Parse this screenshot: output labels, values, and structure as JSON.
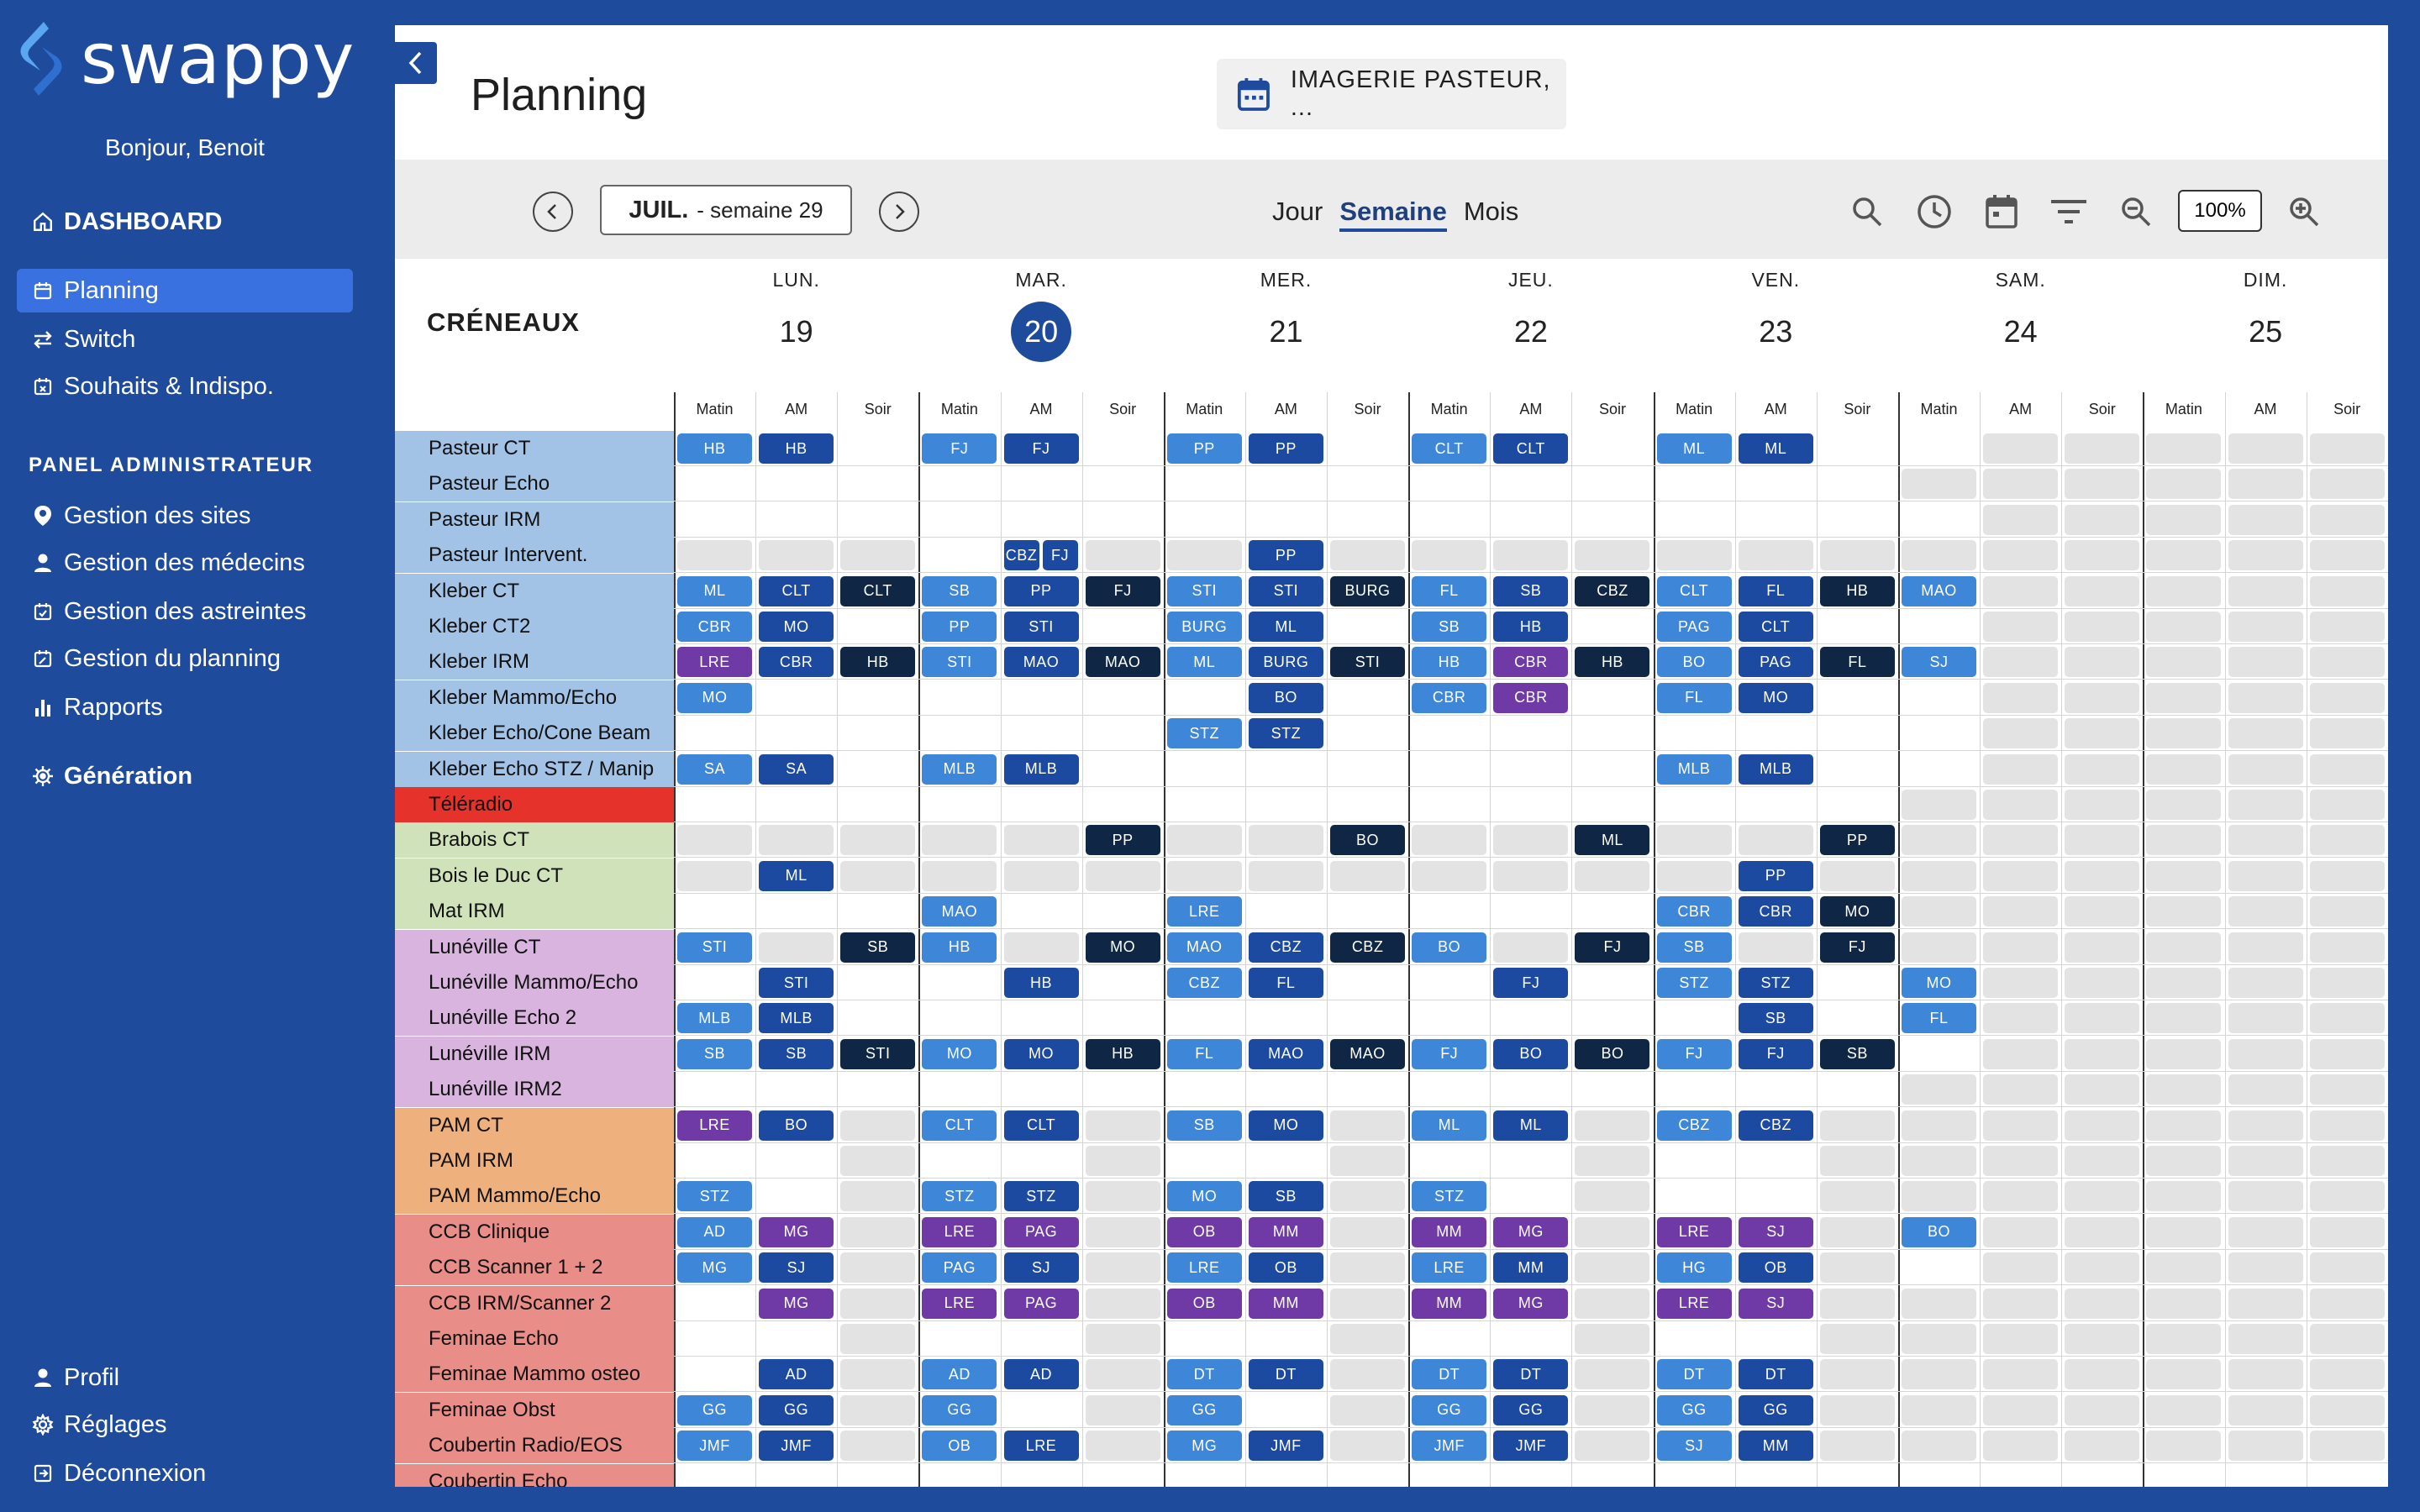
{
  "app": {
    "brand": "swappy",
    "greeting": "Bonjour, Benoit"
  },
  "nav": [
    {
      "label": "DASHBOARD",
      "icon": "home-icon",
      "bold": true
    },
    {
      "label": "Planning",
      "icon": "calendar-icon",
      "selected": true
    },
    {
      "label": "Switch",
      "icon": "swap-icon"
    },
    {
      "label": "Souhaits & Indispo.",
      "icon": "calendar-x-icon"
    }
  ],
  "admin_title": "PANEL ADMINISTRATEUR",
  "admin": [
    {
      "label": "Gestion des sites",
      "icon": "location-icon"
    },
    {
      "label": "Gestion des médecins",
      "icon": "person-icon"
    },
    {
      "label": "Gestion des astreintes",
      "icon": "calendar-check-icon"
    },
    {
      "label": "Gestion du planning",
      "icon": "calendar-edit-icon"
    },
    {
      "label": "Rapports",
      "icon": "bar-chart-icon"
    }
  ],
  "generation": "Génération",
  "bottom": [
    {
      "label": "Profil",
      "icon": "person-icon"
    },
    {
      "label": "Réglages",
      "icon": "gear-icon"
    },
    {
      "label": "Déconnexion",
      "icon": "logout-icon"
    }
  ],
  "header": {
    "title": "Planning",
    "site": "IMAGERIE PASTEUR, ..."
  },
  "toolbar": {
    "month": "JUIL.",
    "week": "- semaine 29",
    "views": [
      "Jour",
      "Semaine",
      "Mois"
    ],
    "active_view": "Semaine",
    "zoom": "100%"
  },
  "creneaux": "CRÉNEAUX",
  "days": [
    {
      "name": "LUN.",
      "num": "19"
    },
    {
      "name": "MAR.",
      "num": "20",
      "today": true
    },
    {
      "name": "MER.",
      "num": "21"
    },
    {
      "name": "JEU.",
      "num": "22"
    },
    {
      "name": "VEN.",
      "num": "23"
    },
    {
      "name": "SAM.",
      "num": "24"
    },
    {
      "name": "DIM.",
      "num": "25"
    }
  ],
  "slots": [
    "Matin",
    "AM",
    "Soir"
  ],
  "colors": {
    "light": "#3d86d8",
    "mid": "#1c4aa0",
    "dark": "#0f2745",
    "purple": "#6f3aa6",
    "blue": "#a2c3e6",
    "red": "#e5322b",
    "green": "#cfe2ba",
    "lilac": "#d8b4df",
    "orange": "#eeb07d",
    "pink": "#e88d87"
  },
  "rows": [
    {
      "label": "Pasteur CT",
      "color": "blue",
      "cells": [
        "L:HB",
        "M:HB",
        "",
        "L:FJ",
        "M:FJ",
        "",
        "L:PP",
        "M:PP",
        "",
        "L:CLT",
        "M:CLT",
        "",
        "L:ML",
        "M:ML",
        "",
        "",
        "g",
        "g",
        "g",
        "g",
        "g"
      ]
    },
    {
      "label": "Pasteur Echo",
      "color": "blue",
      "cells": [
        "",
        "",
        "",
        "",
        "",
        "",
        "",
        "",
        "",
        "",
        "",
        "",
        "",
        "",
        "",
        "g",
        "g",
        "g",
        "g",
        "g",
        "g"
      ]
    },
    {
      "label": "Pasteur IRM",
      "color": "blue",
      "cells": [
        "",
        "",
        "",
        "",
        "",
        "",
        "",
        "",
        "",
        "",
        "",
        "",
        "",
        "",
        "",
        "",
        "g",
        "g",
        "g",
        "g",
        "g"
      ]
    },
    {
      "label": "Pasteur Intervent.",
      "color": "blue",
      "cells": [
        "g",
        "g",
        "g",
        "",
        "M:CBZ|M:FJ",
        "g",
        "g",
        "M:PP",
        "g",
        "g",
        "g",
        "g",
        "g",
        "g",
        "g",
        "g",
        "g",
        "g",
        "g",
        "g",
        "g"
      ]
    },
    {
      "label": "Kleber CT",
      "color": "blue",
      "cells": [
        "L:ML",
        "M:CLT",
        "D:CLT",
        "L:SB",
        "M:PP",
        "D:FJ",
        "L:STI",
        "M:STI",
        "D:BURG",
        "L:FL",
        "M:SB",
        "D:CBZ",
        "L:CLT",
        "M:FL",
        "D:HB",
        "L:MAO",
        "g",
        "g",
        "g",
        "g",
        "g"
      ]
    },
    {
      "label": "Kleber CT2",
      "color": "blue",
      "cells": [
        "L:CBR",
        "M:MO",
        "",
        "L:PP",
        "M:STI",
        "",
        "L:BURG",
        "M:ML",
        "",
        "L:SB",
        "M:HB",
        "",
        "L:PAG",
        "M:CLT",
        "",
        "",
        "g",
        "g",
        "g",
        "g",
        "g"
      ]
    },
    {
      "label": "Kleber IRM",
      "color": "blue",
      "cells": [
        "P:LRE",
        "M:CBR",
        "D:HB",
        "L:STI",
        "M:MAO",
        "D:MAO",
        "L:ML",
        "M:BURG",
        "D:STI",
        "L:HB",
        "P:CBR",
        "D:HB",
        "L:BO",
        "M:PAG",
        "D:FL",
        "L:SJ",
        "g",
        "g",
        "g",
        "g",
        "g"
      ]
    },
    {
      "label": "Kleber Mammo/Echo",
      "color": "blue",
      "cells": [
        "L:MO",
        "",
        "",
        "",
        "",
        "",
        "",
        "M:BO",
        "",
        "L:CBR",
        "P:CBR",
        "",
        "L:FL",
        "M:MO",
        "",
        "",
        "g",
        "g",
        "g",
        "g",
        "g"
      ]
    },
    {
      "label": "Kleber Echo/Cone Beam",
      "color": "blue",
      "cells": [
        "",
        "",
        "",
        "",
        "",
        "",
        "L:STZ",
        "M:STZ",
        "",
        "",
        "",
        "",
        "",
        "",
        "",
        "",
        "g",
        "g",
        "g",
        "g",
        "g"
      ]
    },
    {
      "label": "Kleber Echo STZ / Manip",
      "color": "blue",
      "cells": [
        "L:SA",
        "M:SA",
        "",
        "L:MLB",
        "M:MLB",
        "",
        "",
        "",
        "",
        "",
        "",
        "",
        "L:MLB",
        "M:MLB",
        "",
        "",
        "g",
        "g",
        "g",
        "g",
        "g"
      ]
    },
    {
      "label": "Téléradio",
      "color": "red",
      "cells": [
        "",
        "",
        "",
        "",
        "",
        "",
        "",
        "",
        "",
        "",
        "",
        "",
        "",
        "",
        "",
        "g",
        "g",
        "g",
        "g",
        "g",
        "g"
      ]
    },
    {
      "label": "Brabois CT",
      "color": "green",
      "cells": [
        "g",
        "g",
        "g",
        "g",
        "g",
        "D:PP",
        "g",
        "g",
        "D:BO",
        "g",
        "g",
        "D:ML",
        "g",
        "g",
        "D:PP",
        "g",
        "g",
        "g",
        "g",
        "g",
        "g"
      ]
    },
    {
      "label": "Bois le Duc CT",
      "color": "green",
      "cells": [
        "g",
        "M:ML",
        "g",
        "g",
        "g",
        "g",
        "g",
        "g",
        "g",
        "g",
        "g",
        "g",
        "g",
        "M:PP",
        "g",
        "g",
        "g",
        "g",
        "g",
        "g",
        "g"
      ]
    },
    {
      "label": "Mat IRM",
      "color": "green",
      "cells": [
        "",
        "",
        "",
        "L:MAO",
        "",
        "",
        "L:LRE",
        "",
        "",
        "",
        "",
        "",
        "L:CBR",
        "M:CBR",
        "D:MO",
        "g",
        "g",
        "g",
        "g",
        "g",
        "g"
      ]
    },
    {
      "label": "Lunéville CT",
      "color": "lilac",
      "cells": [
        "L:STI",
        "g",
        "D:SB",
        "L:HB",
        "g",
        "D:MO",
        "L:MAO",
        "M:CBZ",
        "D:CBZ",
        "L:BO",
        "g",
        "D:FJ",
        "L:SB",
        "g",
        "D:FJ",
        "g",
        "g",
        "g",
        "g",
        "g",
        "g"
      ]
    },
    {
      "label": "Lunéville Mammo/Echo",
      "color": "lilac",
      "cells": [
        "",
        "M:STI",
        "",
        "",
        "M:HB",
        "",
        "L:CBZ",
        "M:FL",
        "",
        "",
        "M:FJ",
        "",
        "L:STZ",
        "M:STZ",
        "",
        "L:MO",
        "g",
        "g",
        "g",
        "g",
        "g"
      ]
    },
    {
      "label": "Lunéville Echo 2",
      "color": "lilac",
      "cells": [
        "L:MLB",
        "M:MLB",
        "",
        "",
        "",
        "",
        "",
        "",
        "",
        "",
        "",
        "",
        "",
        "M:SB",
        "",
        "L:FL",
        "g",
        "g",
        "g",
        "g",
        "g"
      ]
    },
    {
      "label": "Lunéville IRM",
      "color": "lilac",
      "cells": [
        "L:SB",
        "M:SB",
        "D:STI",
        "L:MO",
        "M:MO",
        "D:HB",
        "L:FL",
        "M:MAO",
        "D:MAO",
        "L:FJ",
        "M:BO",
        "D:BO",
        "L:FJ",
        "M:FJ",
        "D:SB",
        "",
        "g",
        "g",
        "g",
        "g",
        "g"
      ]
    },
    {
      "label": "Lunéville IRM2",
      "color": "lilac",
      "cells": [
        "",
        "",
        "",
        "",
        "",
        "",
        "",
        "",
        "",
        "",
        "",
        "",
        "",
        "",
        "",
        "g",
        "g",
        "g",
        "g",
        "g",
        "g"
      ]
    },
    {
      "label": "PAM CT",
      "color": "orange",
      "cells": [
        "P:LRE",
        "M:BO",
        "g",
        "L:CLT",
        "M:CLT",
        "g",
        "L:SB",
        "M:MO",
        "g",
        "L:ML",
        "M:ML",
        "g",
        "L:CBZ",
        "M:CBZ",
        "g",
        "g",
        "g",
        "g",
        "g",
        "g",
        "g"
      ]
    },
    {
      "label": "PAM IRM",
      "color": "orange",
      "cells": [
        "",
        "",
        "g",
        "",
        "",
        "g",
        "",
        "",
        "g",
        "",
        "",
        "g",
        "",
        "",
        "g",
        "g",
        "g",
        "g",
        "g",
        "g",
        "g"
      ]
    },
    {
      "label": "PAM Mammo/Echo",
      "color": "orange",
      "cells": [
        "L:STZ",
        "",
        "g",
        "L:STZ",
        "M:STZ",
        "g",
        "L:MO",
        "M:SB",
        "g",
        "L:STZ",
        "",
        "g",
        "",
        "",
        "g",
        "g",
        "g",
        "g",
        "g",
        "g",
        "g"
      ]
    },
    {
      "label": "CCB Clinique",
      "color": "pink",
      "cells": [
        "L:AD",
        "P:MG",
        "g",
        "P:LRE",
        "P:PAG",
        "g",
        "P:OB",
        "P:MM",
        "g",
        "P:MM",
        "P:MG",
        "g",
        "P:LRE",
        "P:SJ",
        "g",
        "L:BO",
        "g",
        "g",
        "g",
        "g",
        "g"
      ]
    },
    {
      "label": "CCB Scanner 1 + 2",
      "color": "pink",
      "cells": [
        "L:MG",
        "M:SJ",
        "g",
        "L:PAG",
        "M:SJ",
        "g",
        "L:LRE",
        "M:OB",
        "g",
        "L:LRE",
        "M:MM",
        "g",
        "L:HG",
        "M:OB",
        "g",
        "",
        "g",
        "g",
        "g",
        "g",
        "g"
      ]
    },
    {
      "label": "CCB IRM/Scanner 2",
      "color": "pink",
      "cells": [
        "",
        "P:MG",
        "g",
        "P:LRE",
        "P:PAG",
        "g",
        "P:OB",
        "P:MM",
        "g",
        "P:MM",
        "P:MG",
        "g",
        "P:LRE",
        "P:SJ",
        "g",
        "g",
        "g",
        "g",
        "g",
        "g",
        "g"
      ]
    },
    {
      "label": "Feminae Echo",
      "color": "pink",
      "cells": [
        "",
        "",
        "g",
        "",
        "",
        "g",
        "",
        "",
        "g",
        "",
        "",
        "g",
        "",
        "",
        "g",
        "g",
        "g",
        "g",
        "g",
        "g",
        "g"
      ]
    },
    {
      "label": "Feminae Mammo osteo",
      "color": "pink",
      "cells": [
        "",
        "M:AD",
        "g",
        "L:AD",
        "M:AD",
        "g",
        "L:DT",
        "M:DT",
        "g",
        "L:DT",
        "M:DT",
        "g",
        "L:DT",
        "M:DT",
        "g",
        "g",
        "g",
        "g",
        "g",
        "g",
        "g"
      ]
    },
    {
      "label": "Feminae Obst",
      "color": "pink",
      "cells": [
        "L:GG",
        "M:GG",
        "g",
        "L:GG",
        "",
        "g",
        "L:GG",
        "",
        "g",
        "L:GG",
        "M:GG",
        "g",
        "L:GG",
        "M:GG",
        "g",
        "g",
        "g",
        "g",
        "g",
        "g",
        "g"
      ]
    },
    {
      "label": "Coubertin Radio/EOS",
      "color": "pink",
      "cells": [
        "L:JMF",
        "M:JMF",
        "g",
        "L:OB",
        "M:LRE",
        "g",
        "L:MG",
        "M:JMF",
        "g",
        "L:JMF",
        "M:JMF",
        "g",
        "L:SJ",
        "M:MM",
        "g",
        "g",
        "g",
        "g",
        "g",
        "g",
        "g"
      ]
    },
    {
      "label": "Coubertin Echo",
      "color": "pink",
      "cells": [
        "",
        "",
        "",
        "",
        "",
        "",
        "",
        "",
        "",
        "",
        "",
        "",
        "",
        "",
        "",
        "",
        "",
        "",
        "",
        "",
        ""
      ]
    }
  ]
}
